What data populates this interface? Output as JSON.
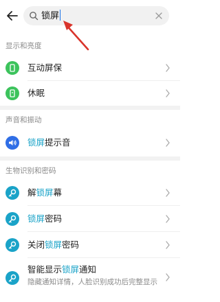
{
  "search": {
    "query": "锁屏"
  },
  "sections": [
    {
      "title": "显示和亮度"
    },
    {
      "title": "声音和振动"
    },
    {
      "title": "生物识别和密码"
    }
  ],
  "items": [
    {
      "pre": "互动屏保",
      "match": "",
      "post": ""
    },
    {
      "pre": "休眠",
      "match": "",
      "post": ""
    },
    {
      "pre": "",
      "match": "锁屏",
      "post": "提示音"
    },
    {
      "pre": "解",
      "match": "锁屏",
      "post": "幕"
    },
    {
      "pre": "",
      "match": "锁屏",
      "post": "密码"
    },
    {
      "pre": "关闭",
      "match": "锁屏",
      "post": "密码"
    },
    {
      "pre": "智能显示",
      "match": "锁屏",
      "post": "通知",
      "sub": "隐藏通知详情，人脸识别成功后完整显示"
    }
  ],
  "colors": {
    "green_icon": "#3cc35c",
    "blue_icon": "#2f6ee6",
    "teal_icon": "#1aa3c8",
    "highlight": "#1aa3c8",
    "annotation_arrow": "#d9342b"
  },
  "icons": [
    "back-arrow-icon",
    "search-icon",
    "clear-icon",
    "screensaver-icon",
    "sleep-icon",
    "sound-icon",
    "key-icon",
    "chevron-right-icon"
  ]
}
